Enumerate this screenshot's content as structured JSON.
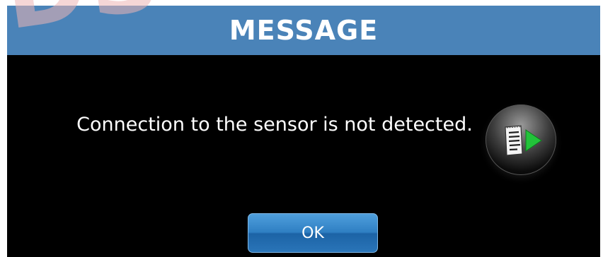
{
  "watermark": {
    "text": "DS"
  },
  "dialog": {
    "title": "MESSAGE",
    "message": "Connection to the sensor is not detected.",
    "ok_label": "OK",
    "report_icon": "report-play-icon"
  },
  "colors": {
    "title_bar": "#4a83b8",
    "dialog_bg": "#000000",
    "button_blue": "#2f7fc3",
    "play_green": "#22c33a"
  }
}
